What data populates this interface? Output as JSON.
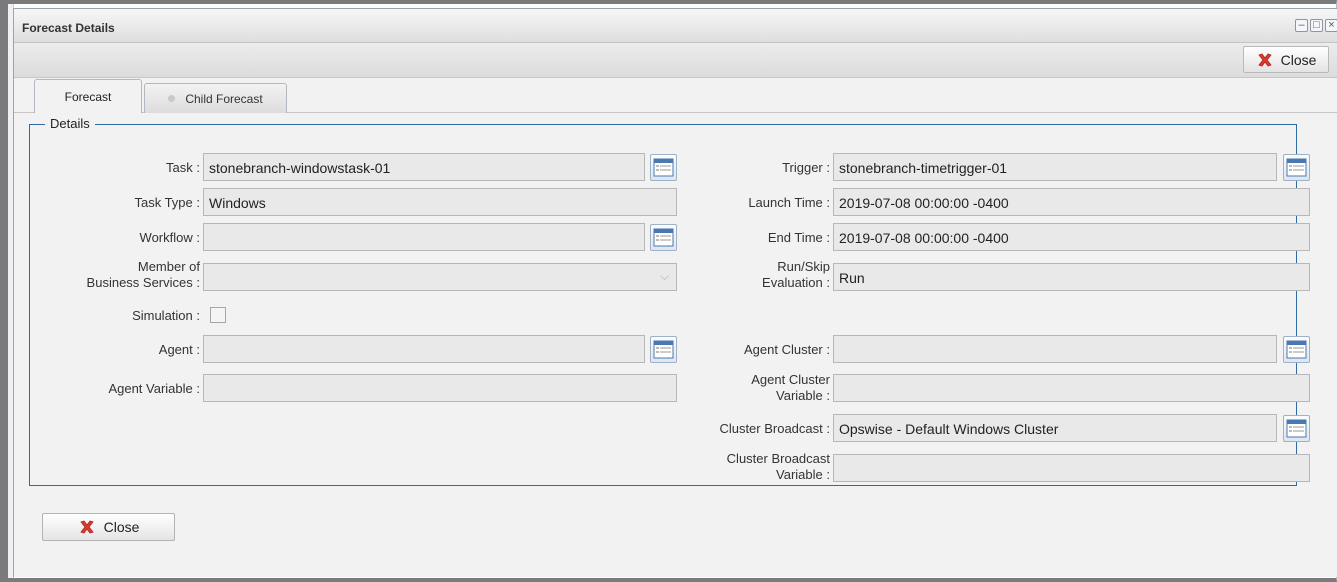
{
  "window": {
    "title": "Forecast Details",
    "controls": [
      "minimize-icon",
      "maximize-icon",
      "close-icon"
    ]
  },
  "toolbar": {
    "close_label": "Close"
  },
  "tabs": [
    {
      "label": "Forecast",
      "active": true
    },
    {
      "label": "Child Forecast",
      "active": false
    }
  ],
  "details": {
    "legend": "Details",
    "left": {
      "task": {
        "label": "Task",
        "value": "stonebranch-windowstask-01"
      },
      "task_type": {
        "label": "Task Type",
        "value": "Windows"
      },
      "workflow": {
        "label": "Workflow",
        "value": ""
      },
      "member_of_business_services": {
        "label_line1": "Member of",
        "label_line2": "Business Services",
        "value": ""
      },
      "simulation": {
        "label": "Simulation",
        "checked": false
      },
      "agent": {
        "label": "Agent",
        "value": ""
      },
      "agent_variable": {
        "label": "Agent Variable",
        "value": ""
      }
    },
    "right": {
      "trigger": {
        "label": "Trigger",
        "value": "stonebranch-timetrigger-01"
      },
      "launch_time": {
        "label": "Launch Time",
        "value": "2019-07-08 00:00:00 -0400"
      },
      "end_time": {
        "label": "End Time",
        "value": "2019-07-08 00:00:00 -0400"
      },
      "run_skip_evaluation": {
        "label_line1": "Run/Skip",
        "label_line2": "Evaluation",
        "value": "Run"
      },
      "agent_cluster": {
        "label": "Agent Cluster",
        "value": ""
      },
      "agent_cluster_variable": {
        "label_line1": "Agent Cluster",
        "label_line2": "Variable",
        "value": ""
      },
      "cluster_broadcast": {
        "label": "Cluster Broadcast",
        "value": "Opswise - Default Windows Cluster"
      },
      "cluster_broadcast_variable": {
        "label_line1": "Cluster Broadcast",
        "label_line2": "Variable",
        "value": ""
      }
    }
  },
  "footer": {
    "close_label": "Close"
  },
  "colors": {
    "accent_border": "#2f6aa3",
    "close_icon": "#e0392d",
    "field_bg": "#e9e9e9"
  }
}
